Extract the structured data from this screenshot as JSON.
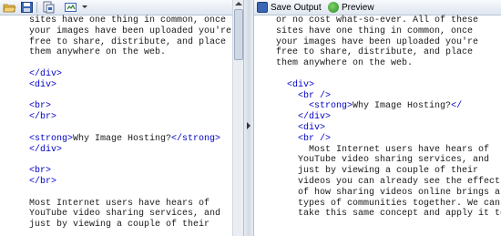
{
  "left_toolbar": {
    "icons": [
      "open-folder-icon",
      "save-icon",
      "open-file-icon",
      "settings-icon"
    ]
  },
  "right_toolbar": {
    "save_output": "Save Output",
    "preview": "Preview"
  },
  "left_code": [
    "sites have one thing in common, once",
    "your images have been uploaded you're",
    "free to share, distribute, and place",
    "them anywhere on the web.",
    "",
    "</div>",
    "<div>",
    "",
    "<br>",
    "</br>",
    "",
    "<strong>Why Image Hosting?</strong>",
    "</div>",
    "",
    "<br>",
    "</br>",
    "",
    "Most Internet users have hears of",
    "YouTube video sharing services, and",
    "just by viewing a couple of their"
  ],
  "right_code": [
    "or no cost what-so-ever. All of these",
    "sites have one thing in common, once",
    "your images have been uploaded you're",
    "free to share, distribute, and place",
    "them anywhere on the web.",
    "",
    "  <div>",
    "    <br />",
    "      <strong>Why Image Hosting?</",
    "    </div>",
    "    <div>",
    "    <br />",
    "      Most Internet users have hears of",
    "    YouTube video sharing services, and",
    "    just by viewing a couple of their",
    "    videos you can already see the effect",
    "    of how sharing videos online brings all",
    "    types of communities together. We can",
    "    take this same concept and apply it to"
  ],
  "colors": {
    "tag": "#0000c8",
    "text": "#1a1a1a"
  }
}
